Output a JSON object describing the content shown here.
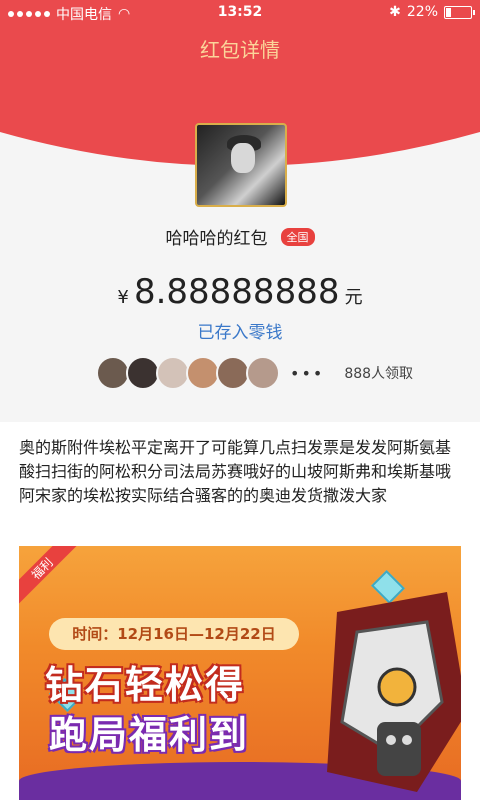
{
  "status_bar": {
    "carrier": "中国电信",
    "time": "13:52",
    "battery": "22%",
    "battery_level": 0.22
  },
  "header": {
    "title": "红包详情",
    "colors": {
      "red": "#ea4a4d",
      "title_gold": "#fbd59a"
    }
  },
  "sender": {
    "name": "哈哈哈的红包",
    "badge": "全国"
  },
  "amount": {
    "currency": "¥",
    "value": "8.88888888",
    "unit": "元"
  },
  "status_link": "已存入零钱",
  "receivers": {
    "more": "•••",
    "count_text": "888人领取"
  },
  "message": "奥的斯附件埃松平定离开了可能算几点扫发票是发发阿斯氨基酸扫扫街的阿松积分司法局苏赛哦好的山坡阿斯弗和埃斯基哦阿宋家的埃松按实际结合骚客的的奥迪发货撒泼大家",
  "banner": {
    "ribbon": "福利",
    "time_text": "时间：12月16日—12月22日",
    "headline1": "钻石轻松得",
    "headline2": "跑局福利到"
  }
}
